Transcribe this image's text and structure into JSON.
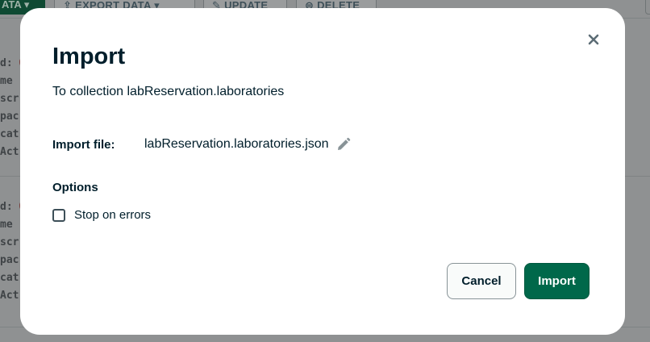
{
  "background": {
    "add_data_label": "ATA",
    "export_label": "EXPORT DATA",
    "update_label": "UPDATE",
    "delete_label": "DELETE",
    "doc1": [
      "d: ",
      "me :",
      "scr",
      "pac",
      "cat",
      "Act"
    ],
    "doc2": [
      "d: ",
      "me :",
      "scr",
      "pac",
      "cat",
      "Act"
    ]
  },
  "modal": {
    "title": "Import",
    "subtitle": "To collection labReservation.laboratories",
    "file_label": "Import file:",
    "file_name": "labReservation.laboratories.json",
    "options_label": "Options",
    "stop_on_errors_label": "Stop on errors",
    "stop_on_errors_checked": false,
    "cancel_label": "Cancel",
    "import_label": "Import"
  },
  "icons": {
    "close": "close-icon",
    "edit": "pencil-icon"
  },
  "colors": {
    "primary_button": "#00684a",
    "text": "#001e2b",
    "overlay": "#8f9192"
  }
}
